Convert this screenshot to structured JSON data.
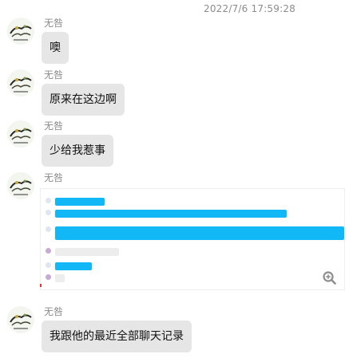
{
  "timestamp": "2022/7/6 17:59:28",
  "messages": [
    {
      "sender": "无咎",
      "text": "噢"
    },
    {
      "sender": "无咎",
      "text": "原来在这边啊"
    },
    {
      "sender": "无咎",
      "text": "少给我惹事"
    },
    {
      "sender": "无咎",
      "image": "chat-screenshot",
      "screenshot": {
        "dates": [
          "",
          ""
        ],
        "bubbles": [
          "",
          "",
          "",
          "",
          "",
          "",
          ""
        ]
      }
    },
    {
      "sender": "无咎",
      "text": "我跟他的最近全部聊天记录"
    }
  ],
  "icons": {
    "zoom": "zoom-in-icon",
    "avatar": "avatar-icon"
  },
  "colors": {
    "bubble": "#e6e6e6",
    "accent": "#12b7f5",
    "name": "#8a8a8a"
  }
}
